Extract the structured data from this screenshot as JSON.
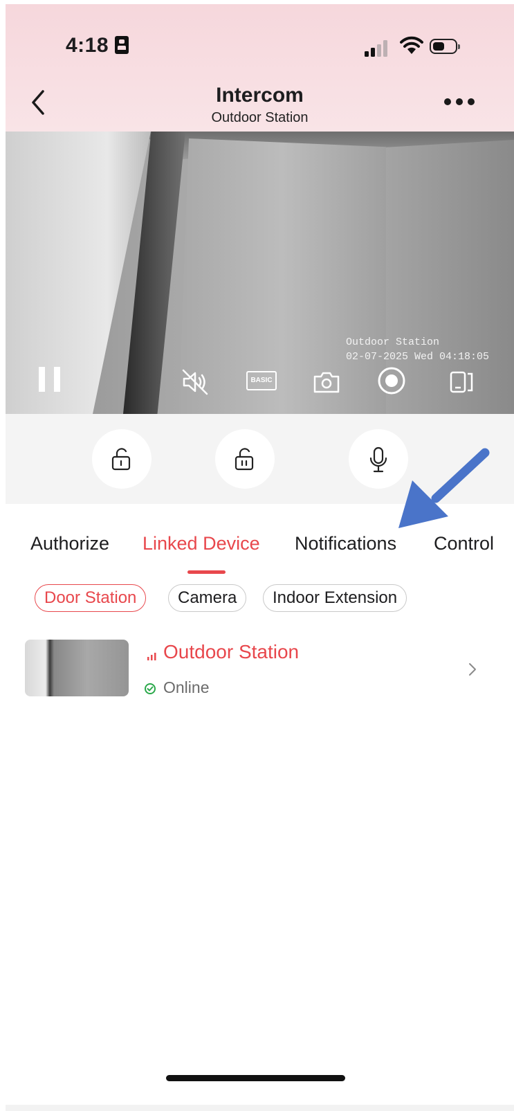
{
  "status_bar": {
    "time": "4:18"
  },
  "header": {
    "title": "Intercom",
    "subtitle": "Outdoor Station"
  },
  "video": {
    "osd_name": "Outdoor Station",
    "osd_timestamp": "02-07-2025 Wed 04:18:05",
    "quality_label": "BASIC"
  },
  "tabs": [
    {
      "label": "Authorize"
    },
    {
      "label": "Linked Device"
    },
    {
      "label": "Notifications"
    },
    {
      "label": "Control"
    }
  ],
  "filters": [
    {
      "label": "Door Station"
    },
    {
      "label": "Camera"
    },
    {
      "label": "Indoor Extension"
    }
  ],
  "device": {
    "name": "Outdoor Station",
    "status": "Online"
  },
  "colors": {
    "accent": "#e8474c",
    "online": "#2aa84a",
    "annotation_arrow": "#4a74c9"
  }
}
